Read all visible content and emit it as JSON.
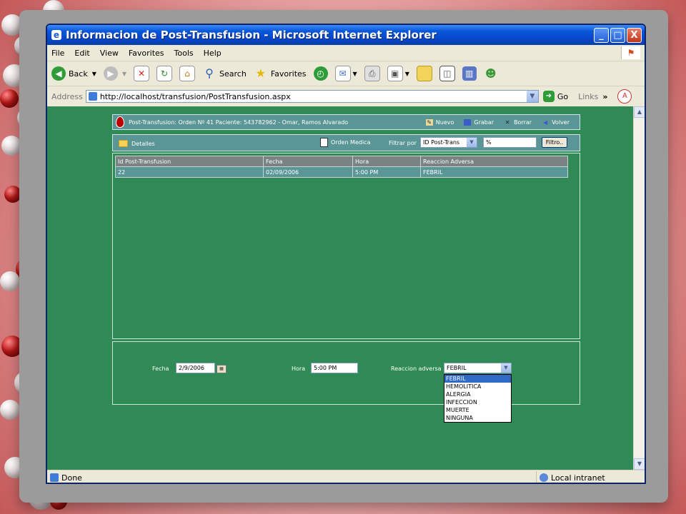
{
  "window": {
    "title": "Informacion de Post-Transfusion - Microsoft Internet Explorer",
    "controls": [
      "_",
      "□",
      "X"
    ]
  },
  "menu": [
    "File",
    "Edit",
    "View",
    "Favorites",
    "Tools",
    "Help"
  ],
  "toolbar": {
    "back_label": "Back",
    "search_label": "Search",
    "favorites_label": "Favorites"
  },
  "address": {
    "label": "Address",
    "url": "http://localhost/transfusion/PostTransfusion.aspx",
    "go_label": "Go",
    "links_label": "Links"
  },
  "page": {
    "header": {
      "title": "Post-Transfusion: Orden Nº 41 Paciente: 543782962 - Omar, Ramos Alvarado",
      "nuevo": "Nuevo",
      "grabar": "Grabar",
      "borrar": "Borrar",
      "volver": "Volver"
    },
    "filter": {
      "detalles": "Detalles",
      "orden_medica": "Orden Medica",
      "filtrar_por": "Filtrar por",
      "select_value": "ID Post-Trans",
      "input_value": "%",
      "button": "Filtro.."
    },
    "table": {
      "columns": [
        "Id Post-Transfusion",
        "Fecha",
        "Hora",
        "Reaccion Adversa"
      ],
      "rows": [
        [
          "22",
          "02/09/2006",
          "5:00 PM",
          "FEBRIL"
        ]
      ]
    },
    "detail": {
      "fecha_label": "Fecha",
      "fecha_value": "2/9/2006",
      "hora_label": "Hora",
      "hora_value": "5:00 PM",
      "reaccion_label": "Reaccion adversa",
      "reaccion_value": "FEBRIL",
      "options": [
        "FEBRIL",
        "HEMOLITICA",
        "ALERGIA",
        "INFECCION",
        "MUERTE",
        "NINGUNA"
      ]
    }
  },
  "status": {
    "left": "Done",
    "zone": "Local intranet"
  },
  "colors": {
    "page_bg": "#2f8a55",
    "panel": "#5b9696",
    "title_blue": "#0a58da"
  }
}
